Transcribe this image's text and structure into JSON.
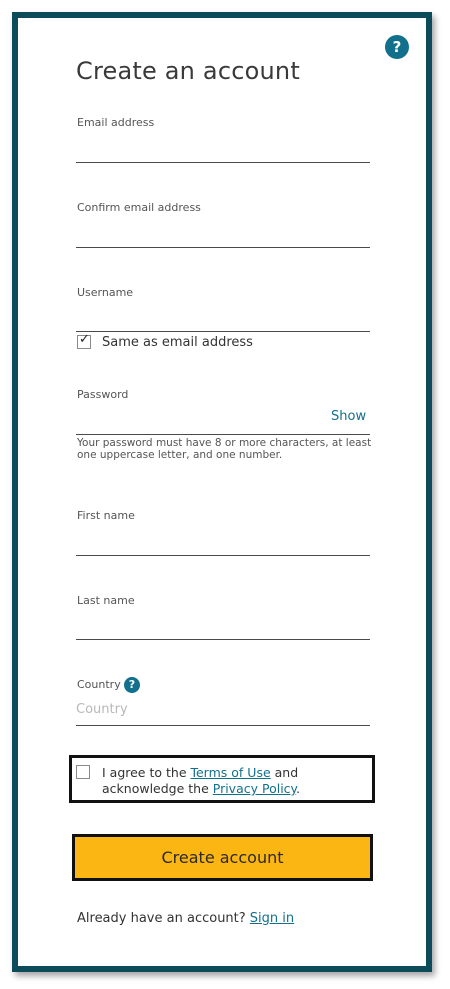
{
  "form": {
    "title": "Create an account",
    "help_icon": "question-icon",
    "email_label": "Email address",
    "email_value": "",
    "confirm_email_label": "Confirm email address",
    "confirm_email_value": "",
    "username_label": "Username",
    "username_value": "",
    "same_as_email_label": "Same as email address",
    "same_as_email_checked": true,
    "password_label": "Password",
    "password_value": "",
    "password_show": "Show",
    "password_hint": "Your password must have 8 or more characters, at least one uppercase letter, and one number.",
    "first_name_label": "First name",
    "first_name_value": "",
    "last_name_label": "Last name",
    "last_name_value": "",
    "country_label": "Country",
    "country_placeholder": "Country",
    "agree_prefix": "I agree to the ",
    "terms_link": "Terms of Use",
    "agree_middle": " and acknowledge the ",
    "privacy_link": "Privacy Policy",
    "agree_suffix": ".",
    "agree_checked": false,
    "submit_label": "Create account",
    "signin_prompt": "Already have an account? ",
    "signin_link": "Sign in"
  },
  "colors": {
    "frame": "#0e4b5a",
    "accent": "#12708c",
    "button": "#fbb614"
  }
}
